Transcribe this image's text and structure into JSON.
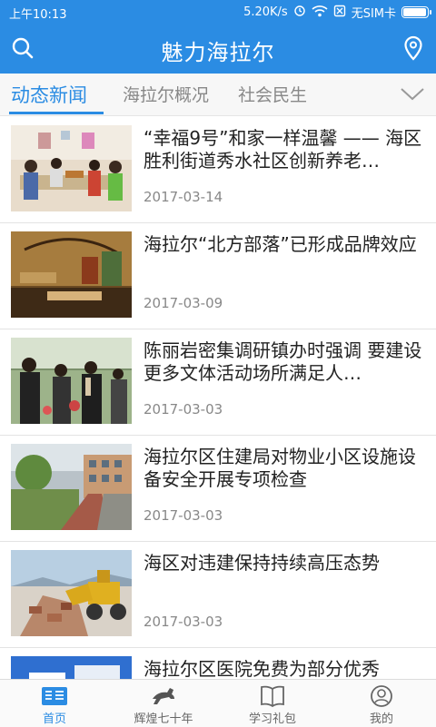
{
  "status_bar": {
    "time": "上午10:13",
    "network_speed": "5.20K/s",
    "sim_status": "无SIM卡",
    "battery_level": 0.9
  },
  "app_bar": {
    "title": "魅力海拉尔",
    "search_icon": "search-icon",
    "location_icon": "location-pin-icon"
  },
  "tabs": [
    {
      "label": "动态新闻",
      "active": true
    },
    {
      "label": "海拉尔概况",
      "active": false
    },
    {
      "label": "社会民生",
      "active": false
    }
  ],
  "news": [
    {
      "title": "“幸福9号”和家一样温馨 —— 海区胜利街道秀水社区创新养老…",
      "date": "2017-03-14"
    },
    {
      "title": "海拉尔“北方部落”已形成品牌效应",
      "date": "2017-03-09"
    },
    {
      "title": "陈丽岩密集调研镇办时强调 要建设更多文体活动场所满足人…",
      "date": "2017-03-03"
    },
    {
      "title": "海拉尔区住建局对物业小区设施设备安全开展专项检查",
      "date": "2017-03-03"
    },
    {
      "title": "海区对违建保持持续高压态势",
      "date": "2017-03-03"
    },
    {
      "title": "海拉尔区医院免费为部分优秀",
      "date": ""
    }
  ],
  "bottom_nav": [
    {
      "label": "首页",
      "icon": "news-home-icon",
      "active": true
    },
    {
      "label": "辉煌七十年",
      "icon": "horse-icon",
      "active": false
    },
    {
      "label": "学习礼包",
      "icon": "book-icon",
      "active": false
    },
    {
      "label": "我的",
      "icon": "user-icon",
      "active": false
    }
  ],
  "colors": {
    "primary": "#2b8ce3",
    "text": "#222222",
    "muted": "#888888"
  }
}
